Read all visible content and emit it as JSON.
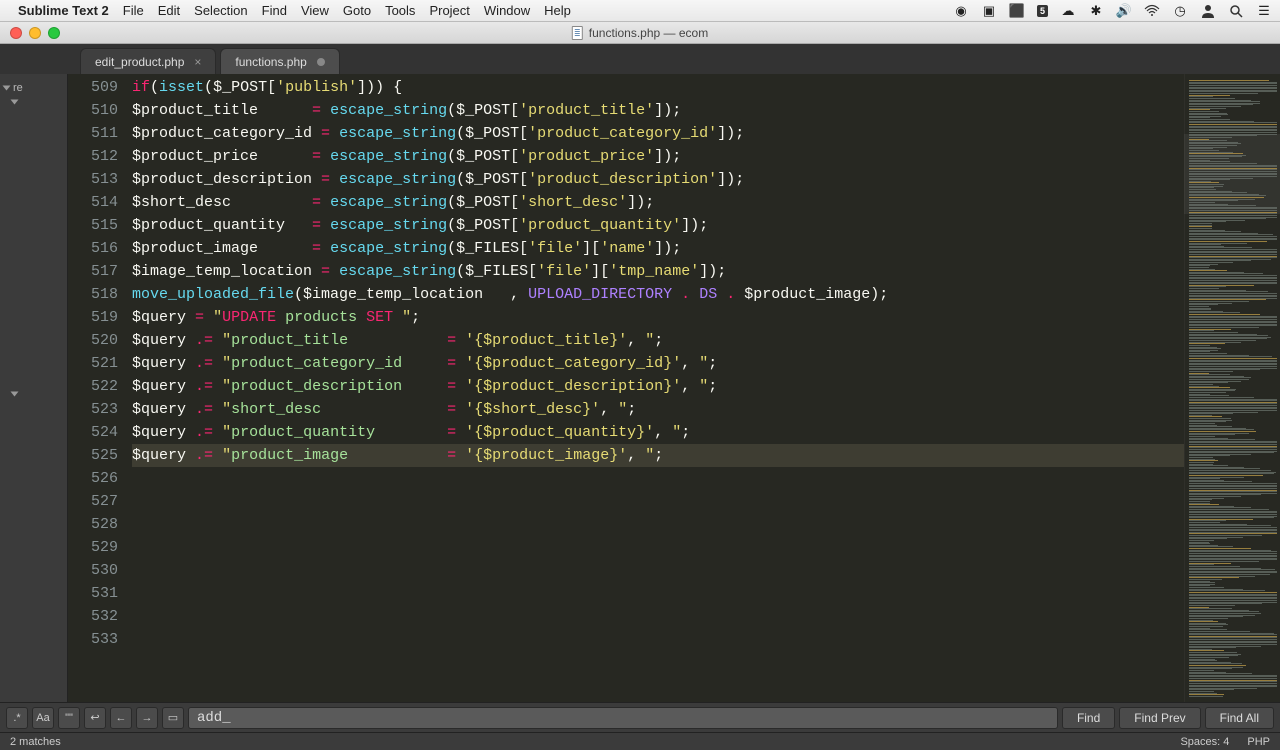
{
  "os_menubar": {
    "app_name": "Sublime Text 2",
    "items": [
      "File",
      "Edit",
      "Selection",
      "Find",
      "View",
      "Goto",
      "Tools",
      "Project",
      "Window",
      "Help"
    ],
    "status_badge": "5"
  },
  "window": {
    "title": "functions.php — ecom"
  },
  "tabs": [
    {
      "label": "edit_product.php",
      "active": false,
      "dirty": false
    },
    {
      "label": "functions.php",
      "active": true,
      "dirty": true
    }
  ],
  "sidebar": {
    "root_label": "re"
  },
  "gutter": {
    "start": 509,
    "end": 533,
    "fold_lines": [
      510,
      514,
      527,
      531
    ]
  },
  "active_line": 531,
  "code": {
    "l510": {
      "kw_if": "if",
      "isset": "isset",
      "post": "$_POST",
      "key": "'publish'"
    },
    "assign": {
      "escape": "escape_string",
      "post": "$_POST",
      "files": "$_FILES",
      "rows": [
        {
          "v": "$product_title",
          "arr": "$_POST",
          "k1": "'product_title'",
          "k2": ""
        },
        {
          "v": "$product_category_id",
          "arr": "$_POST",
          "k1": "'product_category_id'",
          "k2": ""
        },
        {
          "v": "$product_price",
          "arr": "$_POST",
          "k1": "'product_price'",
          "k2": ""
        },
        {
          "v": "$product_description",
          "arr": "$_POST",
          "k1": "'product_description'",
          "k2": ""
        },
        {
          "v": "$short_desc",
          "arr": "$_POST",
          "k1": "'short_desc'",
          "k2": ""
        },
        {
          "v": "$product_quantity",
          "arr": "$_POST",
          "k1": "'product_quantity'",
          "k2": ""
        },
        {
          "v": "$product_image",
          "arr": "$_FILES",
          "k1": "'file'",
          "k2": "'name'"
        },
        {
          "v": "$image_temp_location",
          "arr": "$_FILES",
          "k1": "'file'",
          "k2": "'tmp_name'"
        }
      ]
    },
    "move": {
      "fn": "move_uploaded_file",
      "a1": "$image_temp_location",
      "updir": "UPLOAD_DIRECTORY",
      "ds": "DS",
      "a2": "$product_image"
    },
    "query_start": {
      "v": "$query",
      "sql_update": "UPDATE",
      "sql_tbl": "products",
      "sql_set": "SET"
    },
    "query_rows": [
      {
        "col": "product_title",
        "val": "{$product_title}"
      },
      {
        "col": "product_category_id",
        "val": "{$product_category_id}"
      },
      {
        "col": "product_description",
        "val": "{$product_description}"
      },
      {
        "col": "short_desc",
        "val": "{$short_desc}"
      },
      {
        "col": "product_quantity",
        "val": "{$product_quantity}"
      },
      {
        "col": "product_image",
        "val": "{$product_image}"
      }
    ]
  },
  "findbar": {
    "toggles": [
      ".*",
      "Aa",
      "\"\"",
      "↩",
      "←",
      "→",
      "▭"
    ],
    "value": "add_",
    "find": "Find",
    "find_prev": "Find Prev",
    "find_all": "Find All"
  },
  "statusbar": {
    "matches": "2 matches",
    "spaces": "Spaces: 4",
    "lang": "PHP"
  }
}
